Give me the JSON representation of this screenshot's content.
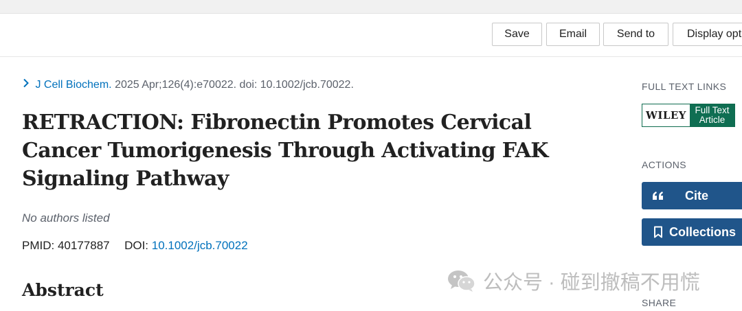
{
  "toolbar": {
    "save_label": "Save",
    "email_label": "Email",
    "send_to_label": "Send to",
    "display_options_label": "Display opt"
  },
  "citation": {
    "journal": "J Cell Biochem.",
    "details": "2025 Apr;126(4):e70022. doi: 10.1002/jcb.70022."
  },
  "article": {
    "title": "RETRACTION: Fibronectin Promotes Cervical Cancer Tumorigenesis Through Activating FAK Signaling Pathway",
    "authors": "No authors listed",
    "pmid_label": "PMID:",
    "pmid": "40177887",
    "doi_label": "DOI:",
    "doi": "10.1002/jcb.70022",
    "abstract_heading": "Abstract"
  },
  "sidebar": {
    "full_text_links_label": "FULL TEXT LINKS",
    "wiley_name": "WILEY",
    "wiley_line1": "Full Text",
    "wiley_line2": "Article",
    "actions_label": "ACTIONS",
    "cite_label": "Cite",
    "collections_label": "Collections",
    "share_label": "SHARE"
  },
  "watermark": {
    "text": "公众号 · 碰到撤稿不用慌"
  },
  "colors": {
    "link": "#0071bc",
    "action_button": "#20558a",
    "wiley_green": "#0f6e52"
  },
  "icons": {
    "journal_chevron": "chevron-right-icon",
    "cite": "quote-icon",
    "collections": "bookmark-icon",
    "watermark": "wechat-icon"
  }
}
